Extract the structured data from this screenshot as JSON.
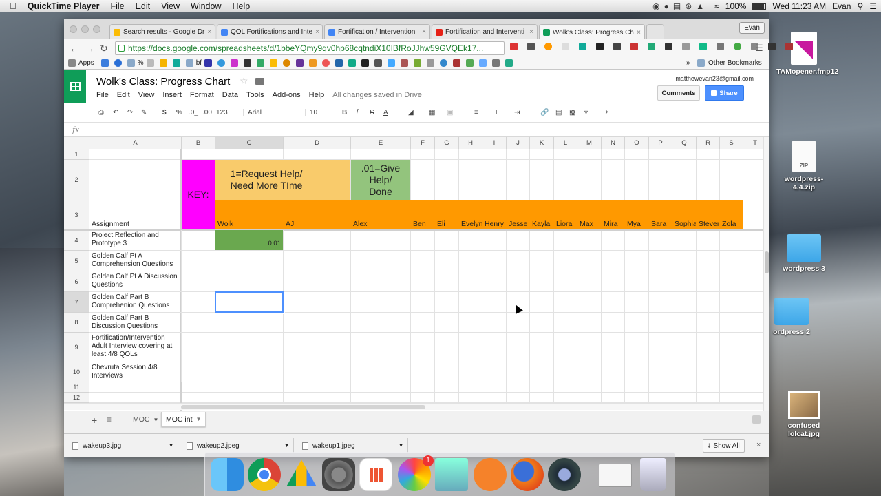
{
  "menubar": {
    "apple": "",
    "app_name": "QuickTime Player",
    "items": [
      "File",
      "Edit",
      "View",
      "Window",
      "Help"
    ],
    "battery": "100%",
    "clock": "Wed 11:23 AM",
    "user": "Evan"
  },
  "desktop": {
    "icons": [
      {
        "label": "TAMopener.fmp12"
      },
      {
        "label": "wordpress-4.4.zip"
      },
      {
        "label": "wordpress 3"
      },
      {
        "label": "ordpress 2"
      },
      {
        "label": "confused lolcat.jpg"
      }
    ]
  },
  "browser": {
    "profile": "Evan",
    "tabs": [
      {
        "title": "Search results - Google Dr",
        "color": "#fbbc05"
      },
      {
        "title": "QOL Fortifications and Inte",
        "color": "#4285f4"
      },
      {
        "title": "Fortification / Intervention",
        "color": "#4285f4"
      },
      {
        "title": "Fortification and Interventi",
        "color": "#e62117"
      },
      {
        "title": "Wolk's Class: Progress Ch",
        "color": "#0f9d58"
      }
    ],
    "url": "https://docs.google.com/spreadsheets/d/1bbeYQmy9qv0hp68cqtndiX10IBfRoJJhw59GVQEk17...",
    "bookmarks": {
      "apps": "Apps",
      "pct": "%",
      "bf": "bf",
      "more": "»",
      "other": "Other Bookmarks"
    }
  },
  "sheet": {
    "title": "Wolk's Class: Progress Chart",
    "menus": [
      "File",
      "Edit",
      "View",
      "Insert",
      "Format",
      "Data",
      "Tools",
      "Add-ons",
      "Help"
    ],
    "saved": "All changes saved in Drive",
    "account": "matthewevan23@gmail.com",
    "comments": "Comments",
    "share": "Share",
    "toolbar": {
      "dollar": "$",
      "percent": "%",
      "dec0": ".0_",
      "dec00": ".00",
      "numfmt": "123",
      "font": "Arial",
      "size": "10",
      "bold": "B",
      "italic": "I",
      "strike": "S",
      "textcolor": "A",
      "sigma": "Σ"
    },
    "fx": "fx",
    "columns": [
      "A",
      "B",
      "C",
      "D",
      "E",
      "F",
      "G",
      "H",
      "I",
      "J",
      "K",
      "L",
      "M",
      "N",
      "O",
      "P",
      "Q",
      "R",
      "S",
      "T"
    ],
    "rows": [
      "1",
      "2",
      "3",
      "4",
      "5",
      "6",
      "7",
      "8",
      "9",
      "10",
      "11",
      "12"
    ],
    "key": {
      "label": "KEY:",
      "request": "1=Request Help/ Need More TIme",
      "give": ".01=Give Help/ Done",
      "colors": {
        "key": "#ff00ff",
        "request": "#f9cb6b",
        "give": "#93c47d",
        "header": "#ff9900",
        "done": "#6aa84f"
      }
    },
    "header_row": {
      "assignment": "Assignment",
      "students": [
        "Wolk",
        "AJ",
        "Alex",
        "Ben",
        "Eli",
        "Evelyn",
        "Henry",
        "Jesse",
        "Kayla",
        "Liora",
        "Max",
        "Mira",
        "Mya",
        "Sara",
        "Sophia",
        "Steven",
        "Zola"
      ]
    },
    "assignments": [
      "Project Reflection and Prototype 3",
      "Golden Calf Pt A Comprehension Questions",
      "Golden Calf Pt A Discussion Questions",
      "Golden Calf Part B Comprehenion Questions",
      "Golden Calf Part B Discussion Questions",
      "Fortification/Intervention Adult Interview covering at least 4/8 QOLs",
      "Chevruta Session 4/8 Interviews"
    ],
    "cell_c4": "0.01",
    "sheet_tabs": [
      {
        "name": "MOC"
      },
      {
        "name": "MOC int"
      }
    ]
  },
  "downloads": {
    "files": [
      "wakeup3.jpg",
      "wakeup2.jpeg",
      "wakeup1.jpeg"
    ],
    "show_all": "Show All"
  }
}
